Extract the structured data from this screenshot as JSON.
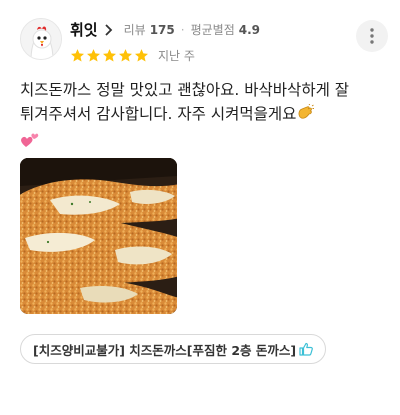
{
  "reviewer": {
    "name": "휘잇",
    "review_label": "리뷰",
    "review_count": "175",
    "average_label": "평균별점",
    "average_rating": "4.9"
  },
  "rating": {
    "stars": 5,
    "max": 5,
    "star_color": "#ffc107"
  },
  "date": "지난 주",
  "review_text": "치즈돈까스 정말 맛있고 괜찮아요. 바삭바삭하게 잘 튀겨주셔서 감사합니다. 자주 시켜먹을게요",
  "emojis": [
    "clapping-hands",
    "two-hearts"
  ],
  "menu_chip": {
    "label": "[치즈양비교불가] 치즈돈까스[푸짐한 2층 돈까스]",
    "icon": "thumbs-up-icon",
    "icon_color": "#3cc0d6"
  }
}
